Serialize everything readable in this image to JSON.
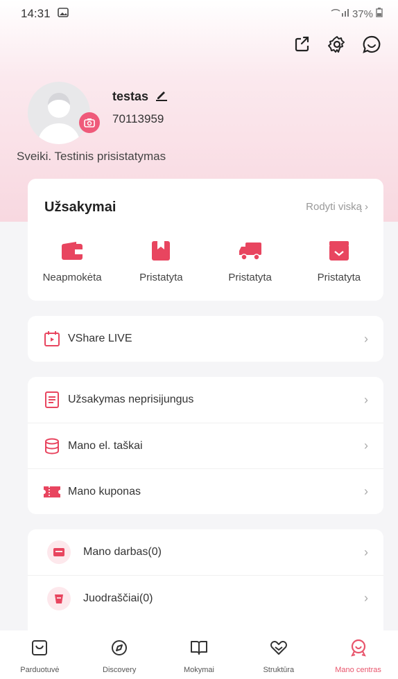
{
  "statusbar": {
    "time": "14:31",
    "battery": "37%"
  },
  "profile": {
    "username": "testas",
    "user_id": "70113959",
    "bio": "Sveiki. Testinis prisistatymas"
  },
  "orders": {
    "title": "Užsakymai",
    "view_all": "Rodyti viską",
    "items": [
      {
        "label": "Neapmokėta",
        "icon": "wallet-icon"
      },
      {
        "label": "Pristatyta",
        "icon": "bookmark-box-icon"
      },
      {
        "label": "Pristatyta",
        "icon": "truck-icon"
      },
      {
        "label": "Pristatyta",
        "icon": "package-icon"
      }
    ]
  },
  "live": {
    "label": "VShare LIVE"
  },
  "menu1": [
    {
      "label": "Užsakymas neprisijungus"
    },
    {
      "label": "Mano el. taškai"
    },
    {
      "label": "Mano kuponas"
    }
  ],
  "menu2": [
    {
      "label": "Mano darbas(0)"
    },
    {
      "label": "Juodraščiai(0)"
    }
  ],
  "tabbar": [
    {
      "label": "Parduotuvė",
      "icon": "store-icon"
    },
    {
      "label": "Discovery",
      "icon": "compass-icon"
    },
    {
      "label": "Mokymai",
      "icon": "book-icon"
    },
    {
      "label": "Struktūra",
      "icon": "structure-icon"
    },
    {
      "label": "Mano centras",
      "icon": "profile-center-icon",
      "active": true
    }
  ],
  "colors": {
    "accent": "#e8546b",
    "hero_pink": "#f8d8e0"
  }
}
